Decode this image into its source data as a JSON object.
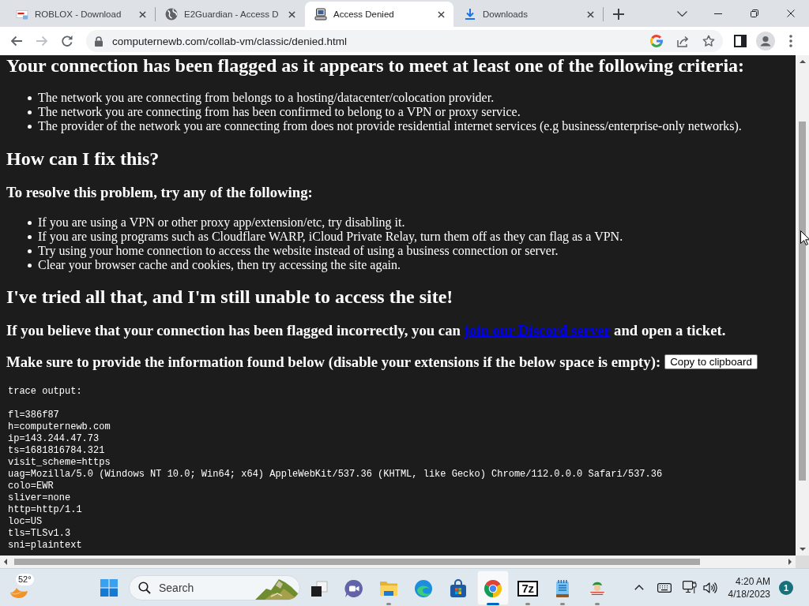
{
  "browser": {
    "tabs": [
      {
        "title": "ROBLOX - Download",
        "selected": false
      },
      {
        "title": "E2Guardian - Access D",
        "selected": false
      },
      {
        "title": "Access Denied",
        "selected": true
      },
      {
        "title": "Downloads",
        "selected": false
      }
    ],
    "navigation": {
      "back_disabled": false,
      "forward_disabled": true
    },
    "address": {
      "url": "computernewb.com/collab-vm/classic/denied.html"
    }
  },
  "page": {
    "criteria": {
      "heading": "Your connection has been flagged as it appears to meet at least one of the following criteria:",
      "items": [
        "The network you are connecting from belongs to a hosting/datacenter/colocation provider.",
        "The network you are connecting from has been confirmed to belong to a VPN or proxy service.",
        "The provider of the network you are connecting from does not provide residential internet services (e.g business/enterprise-only networks)."
      ]
    },
    "fix": {
      "heading": "How can I fix this?",
      "subheading": "To resolve this problem, try any of the following:",
      "items": [
        "If you are using a VPN or other proxy app/extension/etc, try disabling it.",
        "If you are using programs such as Cloudflare WARP, iCloud Private Relay, turn them off as they can flag as a VPN.",
        "Try using your home connection to access the website instead of using a business connection or server.",
        "Clear your browser cache and cookies, then try accessing the site again."
      ]
    },
    "escalate": {
      "heading": "I've tried all that, and I'm still unable to access the site!",
      "ticket_text": {
        "before": "If you believe that your connection has been flagged incorrectly, you can",
        "link": "join our Discord server",
        "after": "and open a ticket."
      },
      "info_text": "Make sure to provide the information found below (disable your extensions if the below space is empty):",
      "copy_button": "Copy to clipboard"
    },
    "trace_output": {
      "title": "trace output:",
      "lines": [
        "fl=386f87",
        "h=computernewb.com",
        "ip=143.244.47.73",
        "ts=1681816784.321",
        "visit_scheme=https",
        "uag=Mozilla/5.0 (Windows NT 10.0; Win64; x64) AppleWebKit/537.36 (KHTML, like Gecko) Chrome/112.0.0.0 Safari/537.36",
        "colo=EWR",
        "sliver=none",
        "http=http/1.1",
        "loc=US",
        "tls=TLSv1.3",
        "sni=plaintext"
      ]
    }
  },
  "taskbar": {
    "weather": {
      "temperature": "52°"
    },
    "search": {
      "placeholder": "Search"
    },
    "apps": [
      {
        "running": false,
        "selected": false
      },
      {
        "running": false,
        "selected": false
      },
      {
        "running": true,
        "selected": false
      },
      {
        "running": false,
        "selected": false
      },
      {
        "running": false,
        "selected": false
      },
      {
        "running": true,
        "selected": true
      },
      {
        "running": true,
        "selected": false,
        "logo_text": "7z"
      },
      {
        "running": true,
        "selected": false
      },
      {
        "running": true,
        "selected": false
      }
    ],
    "clock": {
      "time": "4:20 AM",
      "date": "4/18/2023"
    },
    "notifications": {
      "count": "1"
    }
  }
}
